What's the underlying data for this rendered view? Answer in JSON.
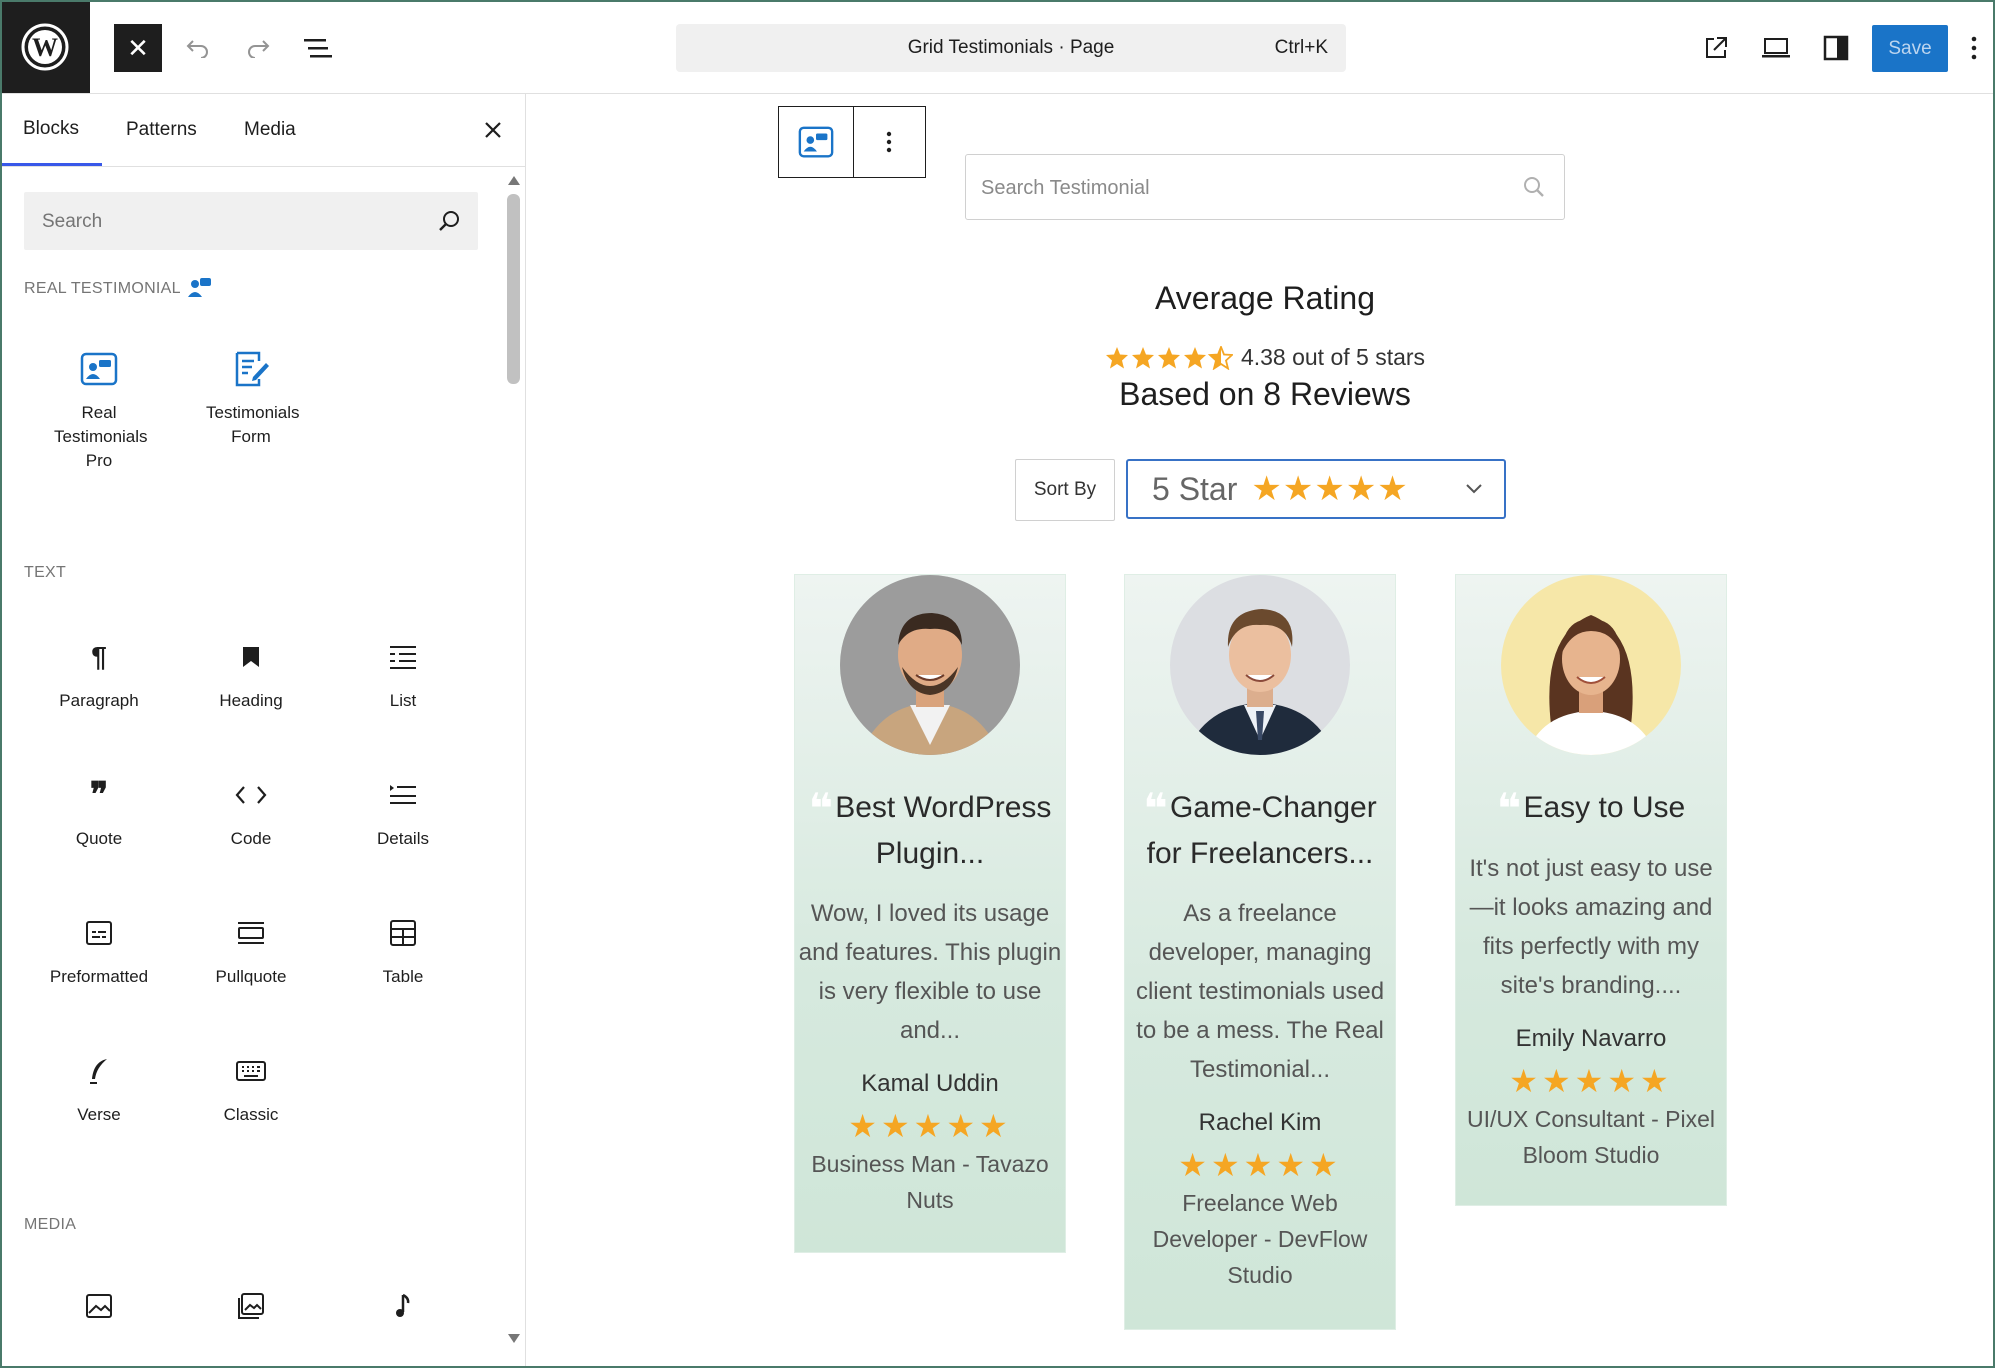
{
  "topbar": {
    "document_title": "Grid Testimonials · Page",
    "shortcut": "Ctrl+K",
    "save_label": "Save",
    "close_symbol": "✕"
  },
  "sidebar": {
    "tabs": [
      {
        "label": "Blocks"
      },
      {
        "label": "Patterns"
      },
      {
        "label": "Media"
      }
    ],
    "search_placeholder": "Search",
    "categories": {
      "real_testimonial": {
        "title": "REAL TESTIMONIAL",
        "items": [
          {
            "label": "Real Testimonials Pro",
            "icon": "testimonial-block-icon"
          },
          {
            "label": "Testimonials Form",
            "icon": "form-icon"
          }
        ]
      },
      "text": {
        "title": "TEXT",
        "items": [
          {
            "label": "Paragraph",
            "icon": "paragraph-icon"
          },
          {
            "label": "Heading",
            "icon": "heading-icon"
          },
          {
            "label": "List",
            "icon": "list-icon"
          },
          {
            "label": "Quote",
            "icon": "quote-icon"
          },
          {
            "label": "Code",
            "icon": "code-icon"
          },
          {
            "label": "Details",
            "icon": "details-icon"
          },
          {
            "label": "Preformatted",
            "icon": "preformatted-icon"
          },
          {
            "label": "Pullquote",
            "icon": "pullquote-icon"
          },
          {
            "label": "Table",
            "icon": "table-icon"
          },
          {
            "label": "Verse",
            "icon": "verse-icon"
          },
          {
            "label": "Classic",
            "icon": "classic-icon"
          }
        ]
      },
      "media": {
        "title": "MEDIA",
        "items": [
          {
            "icon": "image-icon"
          },
          {
            "icon": "gallery-icon"
          },
          {
            "icon": "audio-icon"
          }
        ]
      }
    }
  },
  "canvas": {
    "search_placeholder": "Search Testimonial",
    "average": {
      "title": "Average Rating",
      "rating_text": "4.38 out of 5 stars",
      "rating_value": 4.38,
      "reviews_text": "Based on 8 Reviews"
    },
    "sort": {
      "label": "Sort By",
      "selected": "5 Star",
      "selected_stars": "★★★★★"
    },
    "cards": [
      {
        "title": "Best WordPress Plugin...",
        "text": "Wow, I loved its usage and features. This plugin is very flexible to use and...",
        "name": "Kamal Uddin",
        "stars": "★★★★★",
        "role": "Business Man - Tavazo Nuts"
      },
      {
        "title": "Game-Changer for Freelancers...",
        "text": "As a freelance developer, managing client testimonials used to be a mess. The Real Testimonial...",
        "name": "Rachel Kim",
        "stars": "★★★★★",
        "role": "Freelance Web Developer - DevFlow Studio"
      },
      {
        "title": "Easy to Use",
        "text": "It's not just easy to use—it looks amazing and fits perfectly with my site's branding....",
        "name": "Emily Navarro",
        "stars": "★★★★★",
        "role": "UI/UX Consultant - Pixel Bloom Studio"
      }
    ]
  },
  "colors": {
    "accent": "#3858e9",
    "save_button": "#1a74c8",
    "star": "#f5a623",
    "card_gradient_top": "#eef4f1",
    "card_gradient_bottom": "#cfe6d8"
  }
}
